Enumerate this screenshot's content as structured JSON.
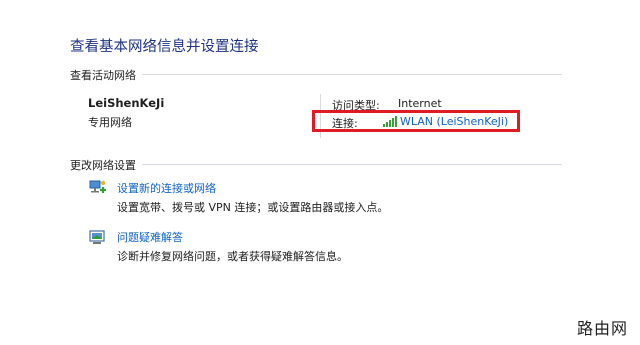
{
  "page_title": "查看基本网络信息并设置连接",
  "active_networks": {
    "section_title": "查看活动网络",
    "network_name": "LeiShenKeJi",
    "network_type": "专用网络",
    "access_type_label": "访问类型:",
    "access_type_value": "Internet",
    "connection_label": "连接:",
    "connection_value": "WLAN (LeiShenKeJi)"
  },
  "change_settings": {
    "section_title": "更改网络设置",
    "tasks": [
      {
        "title": "设置新的连接或网络",
        "desc": "设置宽带、拨号或 VPN 连接；或设置路由器或接入点。",
        "icon": "new-connection-icon"
      },
      {
        "title": "问题疑难解答",
        "desc": "诊断并修复网络问题，或者获得疑难解答信息。",
        "icon": "troubleshoot-icon"
      }
    ]
  },
  "colors": {
    "accent": "#1e3287",
    "link": "#0f64c8",
    "highlight": "#e01b24",
    "signal": "#3aa03a"
  },
  "watermark": "路由网"
}
